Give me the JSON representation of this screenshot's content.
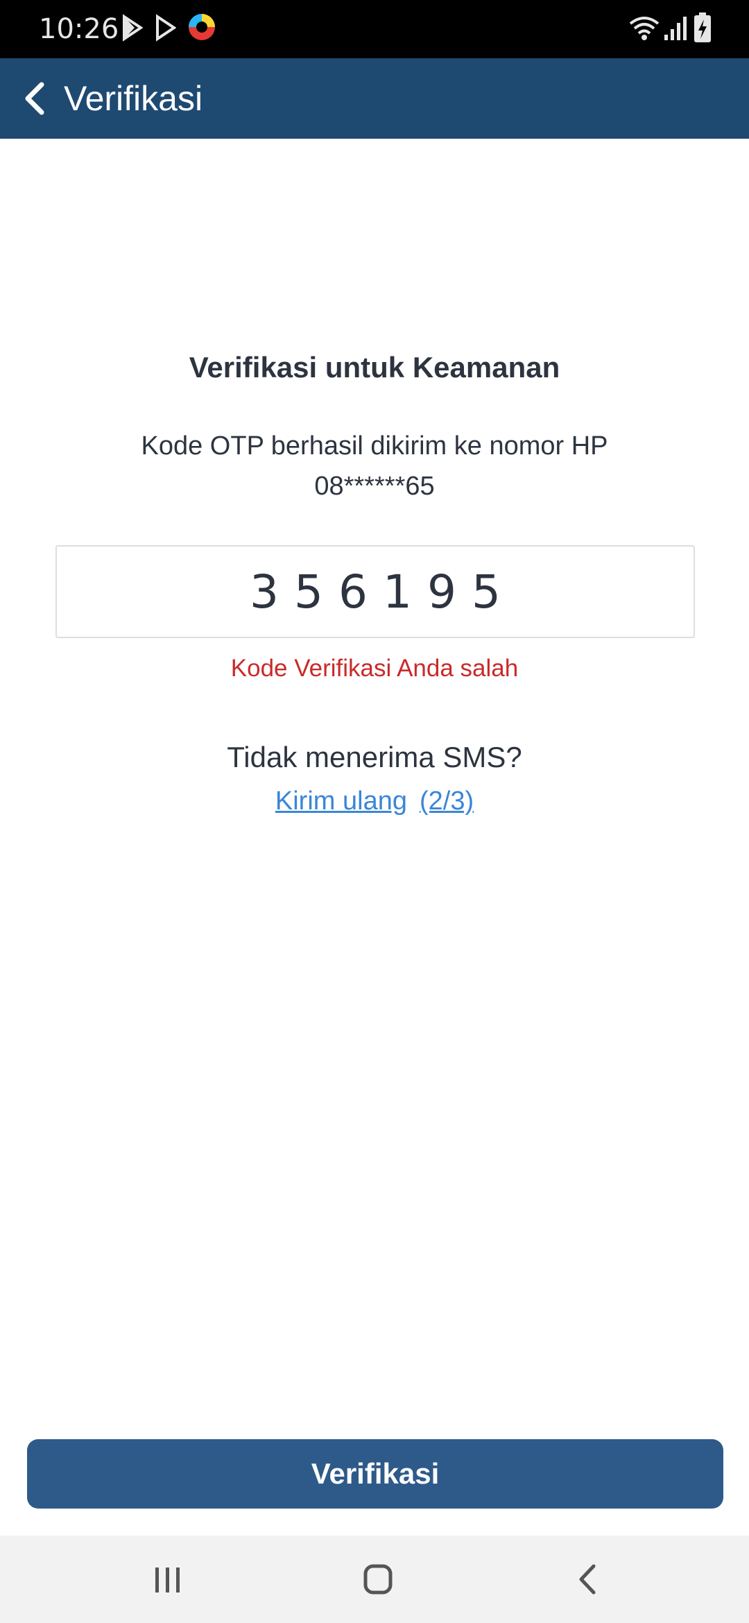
{
  "status_bar": {
    "time": "10:26",
    "left_icons": [
      "play-store-icon",
      "play-store-outline-icon",
      "colorful-app-icon"
    ],
    "right_icons": [
      "wifi-icon",
      "signal-icon",
      "battery-charging-icon"
    ]
  },
  "app_bar": {
    "title": "Verifikasi",
    "back_icon": "chevron-left-icon",
    "color": "#1e4a72"
  },
  "content": {
    "heading": "Verifikasi untuk Keamanan",
    "otp_info_line1": "Kode OTP berhasil dikirim ke nomor HP",
    "otp_info_line2": "08******65",
    "otp_digits": [
      "3",
      "5",
      "6",
      "1",
      "9",
      "5"
    ],
    "error_message": "Kode Verifikasi Anda salah",
    "error_color": "#c92a2a",
    "resend_question": "Tidak menerima SMS?",
    "resend_link": "Kirim ulang",
    "resend_count": "(2/3)",
    "link_color": "#3a86d6"
  },
  "verify_button": {
    "label": "Verifikasi",
    "color": "#2e5a8a"
  },
  "nav_bar": {
    "items": [
      "recent-apps-icon",
      "home-icon",
      "back-icon"
    ]
  }
}
